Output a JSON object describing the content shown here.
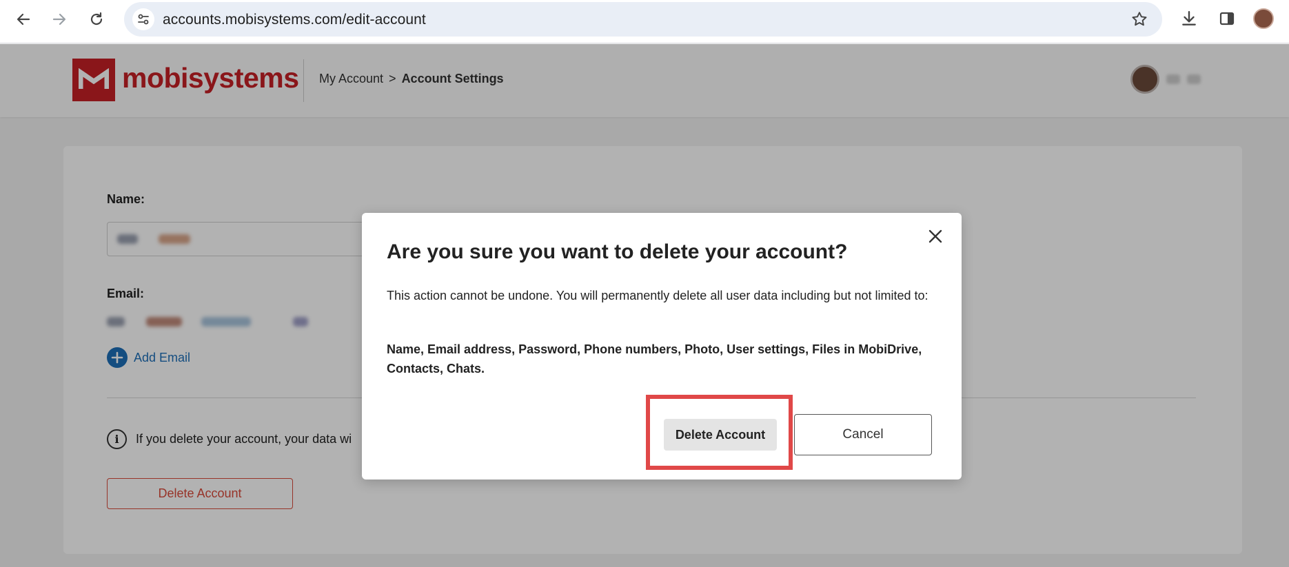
{
  "browser": {
    "url": "accounts.mobisystems.com/edit-account",
    "icons": [
      "back-arrow-icon",
      "forward-arrow-icon",
      "reload-icon",
      "site-settings-icon",
      "bookmark-star-icon",
      "download-icon",
      "side-panel-icon",
      "profile-avatar"
    ]
  },
  "header": {
    "logo_text": "mobisystems",
    "breadcrumb": {
      "parent": "My Account",
      "separator": ">",
      "current": "Account Settings"
    }
  },
  "form": {
    "name_label": "Name:",
    "email_label": "Email:",
    "add_email": "Add Email",
    "info_text": "If you delete your account, your data wi",
    "delete_button": "Delete Account"
  },
  "modal": {
    "title": "Are you sure you want to delete your account?",
    "body": "This action cannot be undone. You will permanently delete all user data including but not limited to:",
    "data_list": "Name, Email address, Password, Phone numbers, Photo, User settings, Files in MobiDrive, Contacts, Chats.",
    "delete_button": "Delete Account",
    "cancel_button": "Cancel"
  },
  "colors": {
    "brand_red": "#c62026",
    "link_blue": "#1e6fb8",
    "highlight_red": "#e04848"
  }
}
